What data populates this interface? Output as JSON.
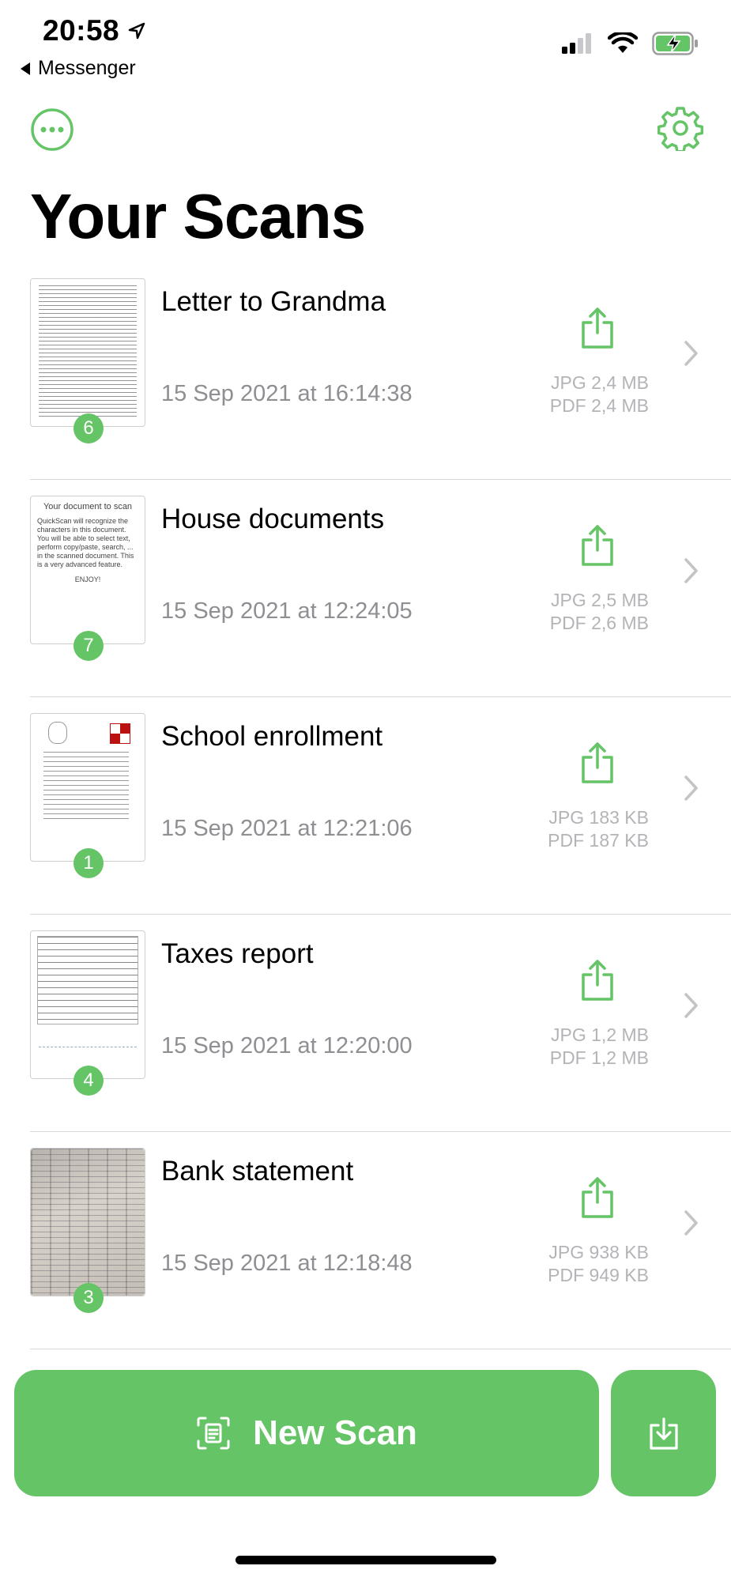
{
  "status_bar": {
    "time": "20:58",
    "back_app": "Messenger"
  },
  "header": {
    "title": "Your Scans"
  },
  "scans": [
    {
      "name": "Letter to Grandma",
      "date": "15 Sep 2021 at 16:14:38",
      "jpg": "JPG 2,4 MB",
      "pdf": "PDF 2,4 MB",
      "pages": "6"
    },
    {
      "name": "House documents",
      "date": "15 Sep 2021 at 12:24:05",
      "jpg": "JPG 2,5 MB",
      "pdf": "PDF 2,6 MB",
      "pages": "7",
      "thumb_title": "Your document to scan",
      "thumb_body": "QuickScan will recognize the characters in this document. You will be able to select text, perform copy/paste, search, ... in the scanned document. This is a very advanced feature.",
      "thumb_footer": "ENJOY!"
    },
    {
      "name": "School enrollment",
      "date": "15 Sep 2021 at 12:21:06",
      "jpg": "JPG 183 KB",
      "pdf": "PDF 187 KB",
      "pages": "1"
    },
    {
      "name": "Taxes report",
      "date": "15 Sep 2021 at 12:20:00",
      "jpg": "JPG 1,2 MB",
      "pdf": "PDF 1,2 MB",
      "pages": "4"
    },
    {
      "name": "Bank statement",
      "date": "15 Sep 2021 at 12:18:48",
      "jpg": "JPG 938 KB",
      "pdf": "PDF 949 KB",
      "pages": "3"
    }
  ],
  "actions": {
    "new_scan": "New Scan"
  },
  "colors": {
    "accent": "#64c466",
    "secondary_text": "#8e8e93",
    "size_text": "#b4b4b8"
  },
  "icons": {
    "more": "ellipsis-circle-icon",
    "settings": "gear-icon",
    "share": "share-icon",
    "chevron": "chevron-right-icon",
    "scan": "document-scan-icon",
    "import": "import-icon"
  }
}
